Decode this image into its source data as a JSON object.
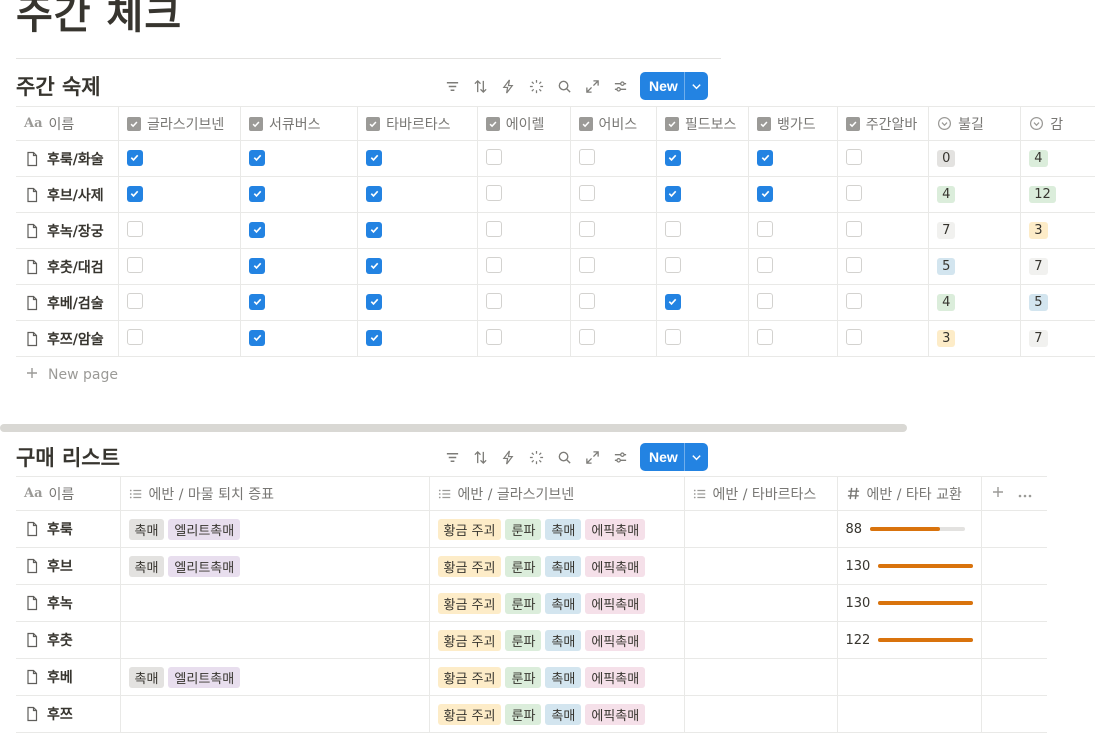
{
  "page": {
    "title": "주간 체크"
  },
  "weekly": {
    "title": "주간 숙제",
    "new_label": "New",
    "new_page_label": "New page",
    "columns": [
      "이름",
      "글라스기브넨",
      "서큐버스",
      "타바르타스",
      "에이렐",
      "어비스",
      "필드보스",
      "뱅가드",
      "주간알바",
      "불길",
      "감"
    ],
    "rows": [
      {
        "name": "후룩/화술",
        "checks": [
          true,
          true,
          true,
          false,
          false,
          true,
          true,
          false
        ],
        "n1": "0",
        "n1_color": "#e3e2e0",
        "n2": "4",
        "n2_color": "#dbeddb"
      },
      {
        "name": "후브/사제",
        "checks": [
          true,
          true,
          true,
          false,
          false,
          true,
          true,
          false
        ],
        "n1": "4",
        "n1_color": "#dbeddb",
        "n2": "12",
        "n2_color": "#dbeddb"
      },
      {
        "name": "후녹/장궁",
        "checks": [
          false,
          true,
          true,
          false,
          false,
          false,
          false,
          false
        ],
        "n1": "7",
        "n1_color": "#f1f1ef",
        "n2": "3",
        "n2_color": "#fdecc8"
      },
      {
        "name": "후춧/대검",
        "checks": [
          false,
          true,
          true,
          false,
          false,
          false,
          false,
          false
        ],
        "n1": "5",
        "n1_color": "#d3e5ef",
        "n2": "7",
        "n2_color": "#f1f1ef"
      },
      {
        "name": "후베/검술",
        "checks": [
          false,
          true,
          true,
          false,
          false,
          true,
          false,
          false
        ],
        "n1": "4",
        "n1_color": "#dbeddb",
        "n2": "5",
        "n2_color": "#d3e5ef"
      },
      {
        "name": "후쯔/암술",
        "checks": [
          false,
          true,
          true,
          false,
          false,
          false,
          false,
          false
        ],
        "n1": "3",
        "n1_color": "#fdecc8",
        "n2": "7",
        "n2_color": "#f1f1ef"
      }
    ]
  },
  "purchase": {
    "title": "구매 리스트",
    "new_label": "New",
    "columns": [
      "이름",
      "에반 / 마물 퇴치 증표",
      "에반 / 글라스기브넨",
      "에반 / 타바르타스",
      "에반 / 타타 교환"
    ],
    "rows": [
      {
        "name": "후룩",
        "t1": [
          "촉매",
          "엘리트촉매"
        ],
        "t2": [
          "황금 주괴",
          "룬파",
          "촉매",
          "에픽촉매"
        ],
        "progress": 88,
        "progress_label": "88"
      },
      {
        "name": "후브",
        "t1": [
          "촉매",
          "엘리트촉매"
        ],
        "t2": [
          "황금 주괴",
          "룬파",
          "촉매",
          "에픽촉매"
        ],
        "progress": 130,
        "progress_label": "130"
      },
      {
        "name": "후녹",
        "t1": [],
        "t2": [
          "황금 주괴",
          "룬파",
          "촉매",
          "에픽촉매"
        ],
        "progress": 130,
        "progress_label": "130"
      },
      {
        "name": "후춧",
        "t1": [],
        "t2": [
          "황금 주괴",
          "룬파",
          "촉매",
          "에픽촉매"
        ],
        "progress": 122,
        "progress_label": "122"
      },
      {
        "name": "후베",
        "t1": [
          "촉매",
          "엘리트촉매"
        ],
        "t2": [
          "황금 주괴",
          "룬파",
          "촉매",
          "에픽촉매"
        ],
        "progress": null,
        "progress_label": ""
      },
      {
        "name": "후쯔",
        "t1": [],
        "t2": [
          "황금 주괴",
          "룬파",
          "촉매",
          "에픽촉매"
        ],
        "progress": null,
        "progress_label": ""
      }
    ],
    "progress_max": 120
  },
  "tag_colors": {
    "촉매": "#e3e2e0",
    "엘리트촉매": "#e8deee",
    "황금 주괴": "#fdecc8",
    "룬파": "#dbeddb",
    "에픽촉매": "#f5e0e9",
    "촉매2": "#d3e5ef"
  },
  "colors": {
    "accent": "#2383e2",
    "progress": "#d9730d"
  },
  "icons": [
    "filter-icon",
    "sort-icon",
    "lightning-icon",
    "sparkle-icon",
    "search-icon",
    "expand-icon",
    "settings-icon",
    "chevron-down-icon",
    "document-icon",
    "checkbox-icon",
    "select-icon",
    "list-icon",
    "hash-icon",
    "plus-icon",
    "more-icon"
  ]
}
